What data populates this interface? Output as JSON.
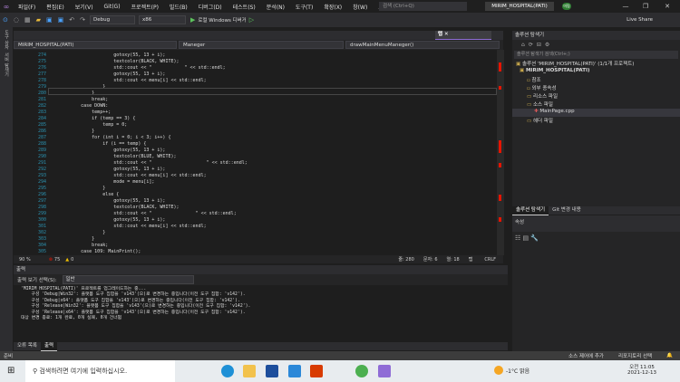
{
  "menu": [
    "파일(F)",
    "편집(E)",
    "보기(V)",
    "Git(G)",
    "프로젝트(P)",
    "빌드(B)",
    "디버그(D)",
    "테스트(S)",
    "분석(N)",
    "도구(T)",
    "확장(X)",
    "창(W)",
    "도움말(H)"
  ],
  "search_placeholder": "검색 (Ctrl+Q)",
  "window_title": "MIRIM_HOSPITAL(PATI)",
  "avatar": "미림",
  "toolbar": {
    "config": "Debug",
    "platform": "x86",
    "run": "로컬 Windows 디버거",
    "live_share": "Live Share"
  },
  "left_tabs": [
    "도구 상자",
    "서버 탐색기"
  ],
  "editor": {
    "tab": "탭",
    "nav": [
      "MIRIM_HOSPITAL(PATI)",
      "Maneger",
      "drawMainMenuManeger()"
    ],
    "lines": [
      {
        "n": "274",
        "t": "                        gotoxy(55, 13 + i);"
      },
      {
        "n": "275",
        "t": "                        textcolor(BLACK, WHITE);"
      },
      {
        "n": "276",
        "t": "                        std::cout << \"            \" << std::endl;"
      },
      {
        "n": "277",
        "t": "                        gotoxy(55, 13 + i);"
      },
      {
        "n": "278",
        "t": "                        std::cout << menu[i] << std::endl;"
      },
      {
        "n": "279",
        "t": "                    }"
      },
      {
        "n": "280",
        "t": "                }"
      },
      {
        "n": "281",
        "t": "                break;"
      },
      {
        "n": "282",
        "t": "            case DOWN:"
      },
      {
        "n": "283",
        "t": "                temp++;"
      },
      {
        "n": "284",
        "t": "                if (temp == 3) {"
      },
      {
        "n": "285",
        "t": "                    temp = 0;"
      },
      {
        "n": "286",
        "t": "                }"
      },
      {
        "n": "287",
        "t": "                for (int i = 0; i < 3; i++) {"
      },
      {
        "n": "288",
        "t": "                    if (i == temp) {"
      },
      {
        "n": "289",
        "t": "                        gotoxy(55, 13 + i);"
      },
      {
        "n": "290",
        "t": "                        textcolor(BLUE, WHITE);"
      },
      {
        "n": "291",
        "t": "                        std::cout << \"                    \" << std::endl;"
      },
      {
        "n": "292",
        "t": "                        gotoxy(55, 13 + i);"
      },
      {
        "n": "293",
        "t": "                        std::cout << menu[i] << std::endl;"
      },
      {
        "n": "294",
        "t": "                        mode = menu[i];"
      },
      {
        "n": "295",
        "t": "                    }"
      },
      {
        "n": "296",
        "t": "                    else {"
      },
      {
        "n": "297",
        "t": "                        gotoxy(55, 13 + i);"
      },
      {
        "n": "298",
        "t": "                        textcolor(BLACK, WHITE);"
      },
      {
        "n": "299",
        "t": "                        std::cout << \"                \" << std::endl;"
      },
      {
        "n": "300",
        "t": "                        gotoxy(55, 13 + i);"
      },
      {
        "n": "301",
        "t": "                        std::cout << menu[i] << std::endl;"
      },
      {
        "n": "302",
        "t": "                    }"
      },
      {
        "n": "303",
        "t": "                }"
      },
      {
        "n": "304",
        "t": "                break;"
      },
      {
        "n": "305",
        "t": "            case 109: MainPrint();"
      }
    ],
    "zoom": "90 %",
    "errors": "75",
    "warnings": "0",
    "line": "줄: 280",
    "char": "문자: 6",
    "col": "열: 18",
    "eol": "CRLF"
  },
  "output": {
    "title": "출력",
    "source_label": "출력 보기 선택(S):",
    "source": "일반",
    "text": "'MIRIM_HOSPITAL(PATI)' 프로젝트를 업그레이드하는 중...\n    구성 'Debug|Win32': 플랫폼 도구 집합을 'v143'(으)로 변경하는 중입니다(이전 도구 집합: 'v142').\n    구성 'Debug|x64': 플랫폼 도구 집합을 'v143'(으)로 변경하는 중입니다(이전 도구 집합: 'v142').\n    구성 'Release|Win32': 플랫폼 도구 집합을 'v143'(으)로 변경하는 중입니다(이전 도구 집합: 'v142').\n    구성 'Release|x64': 플랫폼 도구 집합을 'v143'(으)로 변경하는 중입니다(이전 도구 집합: 'v142').\n대상 변경 종료: 1개 완료, 0개 실패, 0개 건너뜀"
  },
  "bottom_tabs": [
    "오류 목록",
    "출력"
  ],
  "solution": {
    "title": "솔루션 탐색기",
    "search": "솔루션 탐색기 검색(Ctrl+;)",
    "tree": [
      "솔루션 'MIRIM_HOSPITAL(PATI)' (1/1개 프로젝트)",
      "MIRIM_HOSPITAL(PATI)",
      "참조",
      "외부 종속성",
      "리소스 파일",
      "소스 파일",
      "MainPage.cpp",
      "헤더 파일"
    ],
    "tabs": [
      "솔루션 탐색기",
      "Git 변경 내용"
    ]
  },
  "properties": {
    "title": "속성"
  },
  "status": {
    "ready": "준비",
    "source_control": "소스 제어에 추가",
    "repo": "리포지토리 선택"
  },
  "taskbar": {
    "search": "검색하려면 여기에 입력하십시오.",
    "weather": "-1°C 맑음",
    "time": "오전 11:05",
    "date": "2021-12-13"
  },
  "colors": {
    "accent": "#8f6cd6",
    "error": "#e51400"
  }
}
